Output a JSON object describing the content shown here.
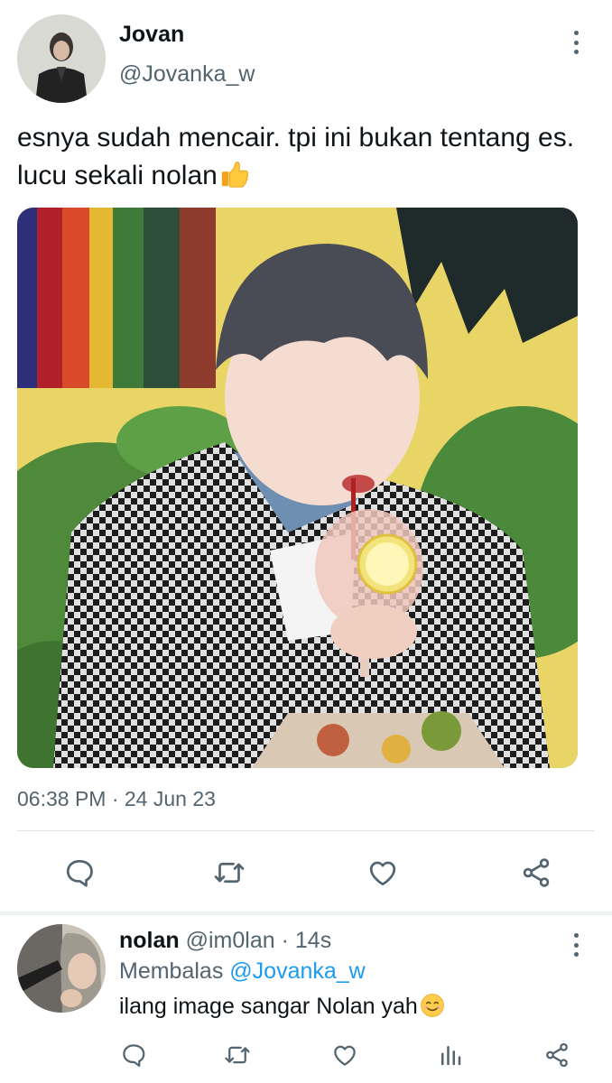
{
  "tweet": {
    "display_name": "Jovan",
    "handle": "@Jovanka_w",
    "text": "esnya sudah mencair. tpi ini bukan tentang es. lucu sekali nolan",
    "emoji": "thumbs-up-emoji",
    "timestamp": "06:38 PM · 24 Jun 23",
    "media": "photo of a person with grey hair in a houndstooth jacket drinking from a glass with a straw",
    "actions": [
      "reply-icon",
      "retweet-icon",
      "like-icon",
      "share-icon"
    ]
  },
  "reply": {
    "display_name": "nolan",
    "handle": "@im0lan",
    "time": "· 14s",
    "replying_label": "Membalas",
    "replying_to": "@Jovanka_w",
    "text": "ilang image sangar Nolan yah",
    "emoji": "smiling-face-emoji",
    "actions": [
      "reply-icon",
      "retweet-icon",
      "like-icon",
      "analytics-icon",
      "share-icon"
    ]
  },
  "colors": {
    "text": "#0f1419",
    "secondary": "#536471",
    "link": "#1d9bf0",
    "divider": "#dfe3e6"
  }
}
